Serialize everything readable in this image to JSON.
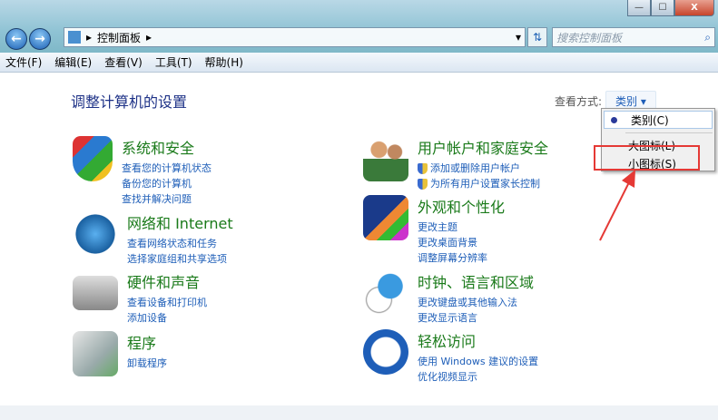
{
  "window": {
    "minimize": "—",
    "maximize": "☐",
    "close": "X"
  },
  "nav": {
    "back": "←",
    "forward": "→"
  },
  "address": {
    "crumb": "控制面板",
    "arrow": "▸",
    "dropdown": "▾"
  },
  "search": {
    "placeholder": "搜索控制面板",
    "icon": "⌕"
  },
  "menu": [
    "文件(F)",
    "编辑(E)",
    "查看(V)",
    "工具(T)",
    "帮助(H)"
  ],
  "page_title": "调整计算机的设置",
  "view_by": {
    "label": "查看方式:",
    "value": "类别 ▾"
  },
  "dropdown": [
    "类别(C)",
    "大图标(L)",
    "小图标(S)"
  ],
  "categories": [
    {
      "title": "系统和安全",
      "links": [
        "查看您的计算机状态",
        "备份您的计算机",
        "查找并解决问题"
      ]
    },
    {
      "title": "网络和 Internet",
      "links": [
        "查看网络状态和任务",
        "选择家庭组和共享选项"
      ]
    },
    {
      "title": "硬件和声音",
      "links": [
        "查看设备和打印机",
        "添加设备"
      ]
    },
    {
      "title": "程序",
      "links": [
        "卸载程序"
      ]
    },
    {
      "title": "用户帐户和家庭安全",
      "links": [
        "添加或删除用户帐户",
        "为所有用户设置家长控制"
      ]
    },
    {
      "title": "外观和个性化",
      "links": [
        "更改主题",
        "更改桌面背景",
        "调整屏幕分辨率"
      ]
    },
    {
      "title": "时钟、语言和区域",
      "links": [
        "更改键盘或其他输入法",
        "更改显示语言"
      ]
    },
    {
      "title": "轻松访问",
      "links": [
        "使用 Windows 建议的设置",
        "优化视频显示"
      ]
    }
  ],
  "colors": {
    "title": "#1e3287",
    "link": "#1e5eb8",
    "category": "#1a7a1a",
    "highlight": "#e53935"
  }
}
